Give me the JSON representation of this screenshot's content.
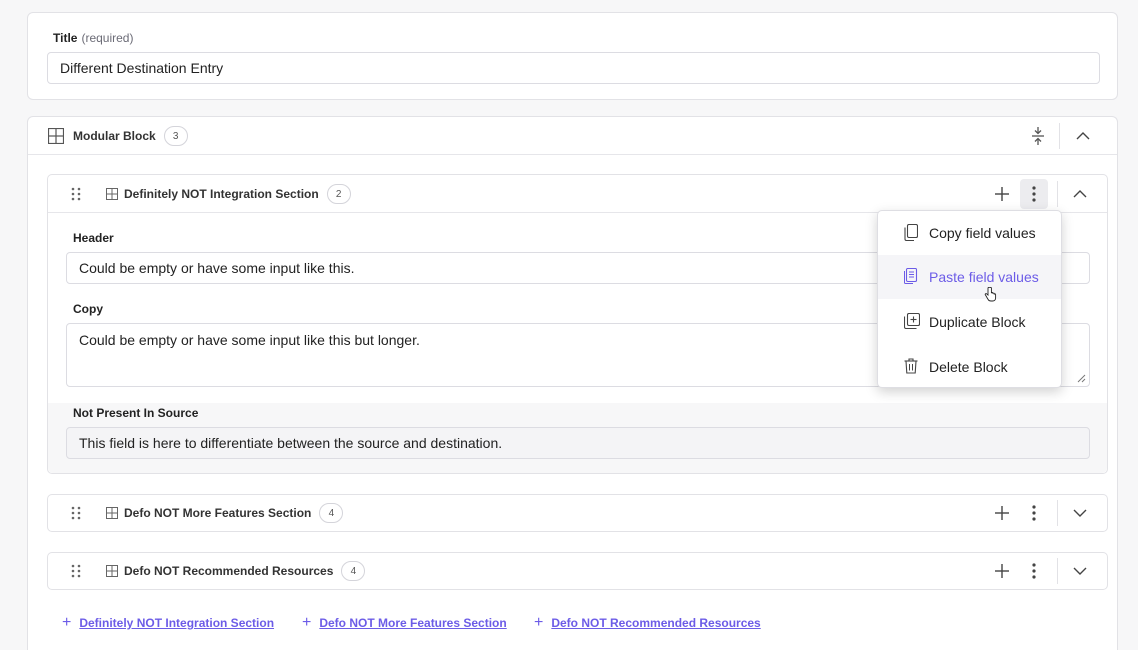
{
  "title_field": {
    "label": "Title",
    "hint": "(required)",
    "value": "Different Destination Entry"
  },
  "modular_block": {
    "label": "Modular Block",
    "count": "3"
  },
  "blocks": [
    {
      "name": "Definitely NOT Integration Section",
      "count": "2",
      "expanded": true,
      "fields": {
        "header_label": "Header",
        "header_value": "Could be empty or have some input like this.",
        "copy_label": "Copy",
        "copy_value": "Could be empty or have some input like this but longer.",
        "np_label": "Not Present In Source",
        "np_value": "This field is here to differentiate between the source and destination."
      }
    },
    {
      "name": "Defo NOT More Features Section",
      "count": "4",
      "expanded": false
    },
    {
      "name": "Defo NOT Recommended Resources",
      "count": "4",
      "expanded": false
    }
  ],
  "context_menu": {
    "items": [
      {
        "label": "Copy field values",
        "icon": "copy-icon"
      },
      {
        "label": "Paste field values",
        "icon": "paste-icon",
        "hovered": true
      },
      {
        "label": "Duplicate Block",
        "icon": "duplicate-icon"
      },
      {
        "label": "Delete Block",
        "icon": "trash-icon"
      }
    ]
  },
  "add_links": [
    "Definitely NOT Integration Section",
    "Defo NOT More Features Section",
    "Defo NOT Recommended Resources"
  ],
  "colors": {
    "accent": "#6c5ce7",
    "border": "#e2e2e6",
    "background": "#f7f7f8"
  }
}
